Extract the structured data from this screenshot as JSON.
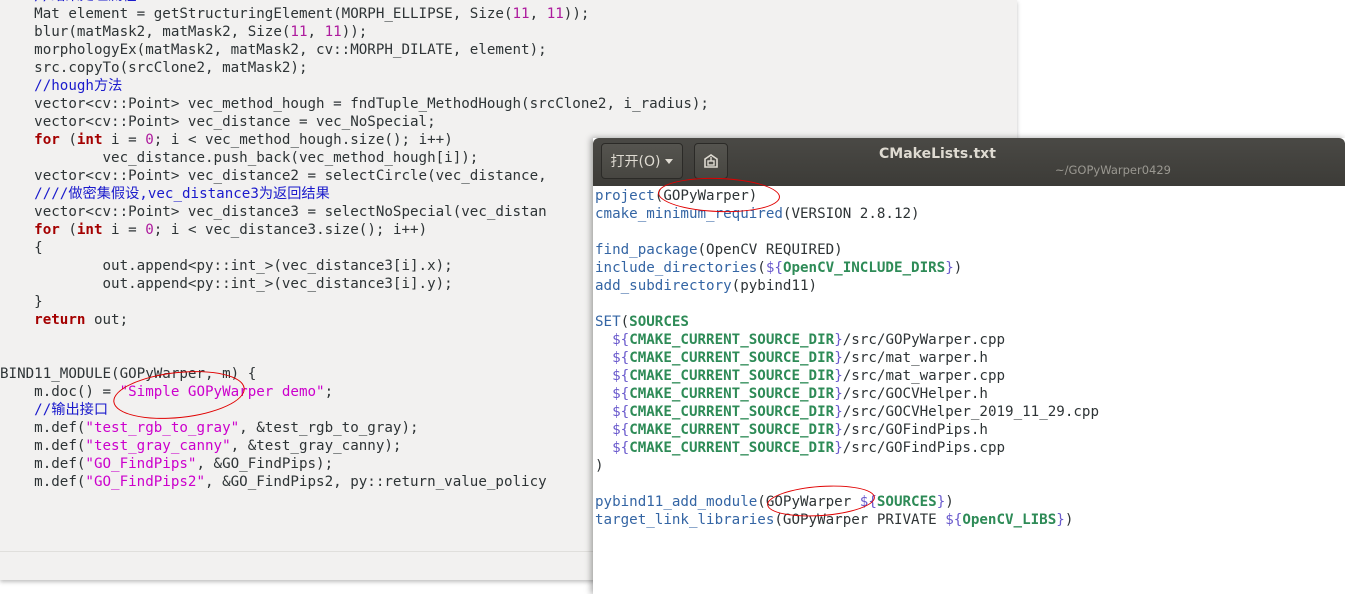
{
  "background_code": [
    [
      [
        "",
        "    "
      ],
      [
        "cm",
        "//结果处理流程"
      ]
    ],
    [
      [
        "",
        "    Mat element = getStructuringElement(MORPH_ELLIPSE, Size("
      ],
      [
        "num",
        "11"
      ],
      [
        "",
        ", "
      ],
      [
        "num",
        "11"
      ],
      [
        "",
        "));"
      ]
    ],
    [
      [
        "",
        "    blur(matMask2, matMask2, Size("
      ],
      [
        "num",
        "11"
      ],
      [
        "",
        ", "
      ],
      [
        "num",
        "11"
      ],
      [
        "",
        "));"
      ]
    ],
    [
      [
        "",
        "    morphologyEx(matMask2, matMask2, cv::MORPH_DILATE, element);"
      ]
    ],
    [
      [
        "",
        "    src.copyTo(srcClone2, matMask2);"
      ]
    ],
    [
      [
        "",
        "    "
      ],
      [
        "cm",
        "//hough方法"
      ]
    ],
    [
      [
        "",
        "    vector<cv::Point> vec_method_hough = fndTuple_MethodHough(srcClone2, i_radius);"
      ]
    ],
    [
      [
        "",
        "    vector<cv::Point> vec_distance = vec_NoSpecial;"
      ]
    ],
    [
      [
        "",
        "    "
      ],
      [
        "kw",
        "for"
      ],
      [
        "",
        " ("
      ],
      [
        "kw",
        "int"
      ],
      [
        "",
        " i = "
      ],
      [
        "num",
        "0"
      ],
      [
        "",
        "; i < vec_method_hough.size(); i++)"
      ]
    ],
    [
      [
        "",
        "            vec_distance.push_back(vec_method_hough[i]);"
      ]
    ],
    [
      [
        "",
        "    vector<cv::Point> vec_distance2 = selectCircle(vec_distance, "
      ]
    ],
    [
      [
        "",
        "    "
      ],
      [
        "cm",
        "////做密集假设,vec_distance3为返回结果"
      ]
    ],
    [
      [
        "",
        "    vector<cv::Point> vec_distance3 = selectNoSpecial(vec_distan"
      ]
    ],
    [
      [
        "",
        "    "
      ],
      [
        "kw",
        "for"
      ],
      [
        "",
        " ("
      ],
      [
        "kw",
        "int"
      ],
      [
        "",
        " i = "
      ],
      [
        "num",
        "0"
      ],
      [
        "",
        "; i < vec_distance3.size(); i++)"
      ]
    ],
    [
      [
        "",
        "    {"
      ]
    ],
    [
      [
        "",
        "            out.append<py::int_>(vec_distance3[i].x);"
      ]
    ],
    [
      [
        "",
        "            out.append<py::int_>(vec_distance3[i].y);"
      ]
    ],
    [
      [
        "",
        "    }"
      ]
    ],
    [
      [
        "",
        "    "
      ],
      [
        "kw",
        "return"
      ],
      [
        "",
        " out;"
      ]
    ],
    [
      [
        "",
        ""
      ]
    ],
    [
      [
        "",
        ""
      ]
    ],
    [
      [
        "",
        "BIND11_MODULE(GOPyWarper, m) {"
      ]
    ],
    [
      [
        "",
        "    m.doc() = "
      ],
      [
        "str",
        "\"Simple GOPyWarper demo\""
      ],
      [
        "",
        ";"
      ]
    ],
    [
      [
        "",
        "    "
      ],
      [
        "cm",
        "//输出接口"
      ]
    ],
    [
      [
        "",
        "    m.def("
      ],
      [
        "str",
        "\"test_rgb_to_gray\""
      ],
      [
        "",
        ", &test_rgb_to_gray);"
      ]
    ],
    [
      [
        "",
        "    m.def("
      ],
      [
        "str",
        "\"test_gray_canny\""
      ],
      [
        "",
        ", &test_gray_canny);"
      ]
    ],
    [
      [
        "",
        "    m.def("
      ],
      [
        "str",
        "\"GO_FindPips\""
      ],
      [
        "",
        ", &GO_FindPips);"
      ]
    ],
    [
      [
        "",
        "    m.def("
      ],
      [
        "str",
        "\"GO_FindPips2\""
      ],
      [
        "",
        ", &GO_FindPips2, py::return_value_policy"
      ]
    ]
  ],
  "window": {
    "open_label": "打开(O)",
    "title": "CMakeLists.txt",
    "subtitle": "~/GOPyWarper0429"
  },
  "cmake_code": [
    [
      [
        "fn",
        "project"
      ],
      [
        "",
        "(GOPyWarper)"
      ]
    ],
    [
      [
        "fn",
        "cmake_minimum_required"
      ],
      [
        "",
        "(VERSION 2.8.12)"
      ]
    ],
    [
      [
        "",
        ""
      ]
    ],
    [
      [
        "fn",
        "find_package"
      ],
      [
        "",
        "(OpenCV REQUIRED)"
      ]
    ],
    [
      [
        "fn",
        "include_directories"
      ],
      [
        "",
        "("
      ],
      [
        "dl",
        "${"
      ],
      [
        "var",
        "OpenCV_INCLUDE_DIRS"
      ],
      [
        "dl",
        "}"
      ],
      [
        "",
        ")"
      ]
    ],
    [
      [
        "fn",
        "add_subdirectory"
      ],
      [
        "",
        "(pybind11)"
      ]
    ],
    [
      [
        "",
        ""
      ]
    ],
    [
      [
        "fn",
        "SET"
      ],
      [
        "",
        "("
      ],
      [
        "var",
        "SOURCES"
      ]
    ],
    [
      [
        "",
        "  "
      ],
      [
        "dl",
        "${"
      ],
      [
        "var",
        "CMAKE_CURRENT_SOURCE_DIR"
      ],
      [
        "dl",
        "}"
      ],
      [
        "",
        "/src/GOPyWarper.cpp"
      ]
    ],
    [
      [
        "",
        "  "
      ],
      [
        "dl",
        "${"
      ],
      [
        "var",
        "CMAKE_CURRENT_SOURCE_DIR"
      ],
      [
        "dl",
        "}"
      ],
      [
        "",
        "/src/mat_warper.h"
      ]
    ],
    [
      [
        "",
        "  "
      ],
      [
        "dl",
        "${"
      ],
      [
        "var",
        "CMAKE_CURRENT_SOURCE_DIR"
      ],
      [
        "dl",
        "}"
      ],
      [
        "",
        "/src/mat_warper.cpp"
      ]
    ],
    [
      [
        "",
        "  "
      ],
      [
        "dl",
        "${"
      ],
      [
        "var",
        "CMAKE_CURRENT_SOURCE_DIR"
      ],
      [
        "dl",
        "}"
      ],
      [
        "",
        "/src/GOCVHelper.h"
      ]
    ],
    [
      [
        "",
        "  "
      ],
      [
        "dl",
        "${"
      ],
      [
        "var",
        "CMAKE_CURRENT_SOURCE_DIR"
      ],
      [
        "dl",
        "}"
      ],
      [
        "",
        "/src/GOCVHelper_2019_11_29.cpp"
      ]
    ],
    [
      [
        "",
        "  "
      ],
      [
        "dl",
        "${"
      ],
      [
        "var",
        "CMAKE_CURRENT_SOURCE_DIR"
      ],
      [
        "dl",
        "}"
      ],
      [
        "",
        "/src/GOFindPips.h"
      ]
    ],
    [
      [
        "",
        "  "
      ],
      [
        "dl",
        "${"
      ],
      [
        "var",
        "CMAKE_CURRENT_SOURCE_DIR"
      ],
      [
        "dl",
        "}"
      ],
      [
        "",
        "/src/GOFindPips.cpp"
      ]
    ],
    [
      [
        "",
        ")"
      ]
    ],
    [
      [
        "",
        ""
      ]
    ],
    [
      [
        "fn",
        "pybind11_add_module"
      ],
      [
        "",
        "(GOPyWarper "
      ],
      [
        "dl",
        "${"
      ],
      [
        "var",
        "SOURCES"
      ],
      [
        "dl",
        "}"
      ],
      [
        "",
        ")"
      ]
    ],
    [
      [
        "fn",
        "target_link_libraries"
      ],
      [
        "",
        "(GOPyWarper PRIVATE "
      ],
      [
        "dl",
        "${"
      ],
      [
        "var",
        "OpenCV_LIBS"
      ],
      [
        "dl",
        "}"
      ],
      [
        "",
        ")"
      ]
    ]
  ],
  "colors": {
    "annotation": "#e00000",
    "titlebar": "#3c3b37"
  }
}
